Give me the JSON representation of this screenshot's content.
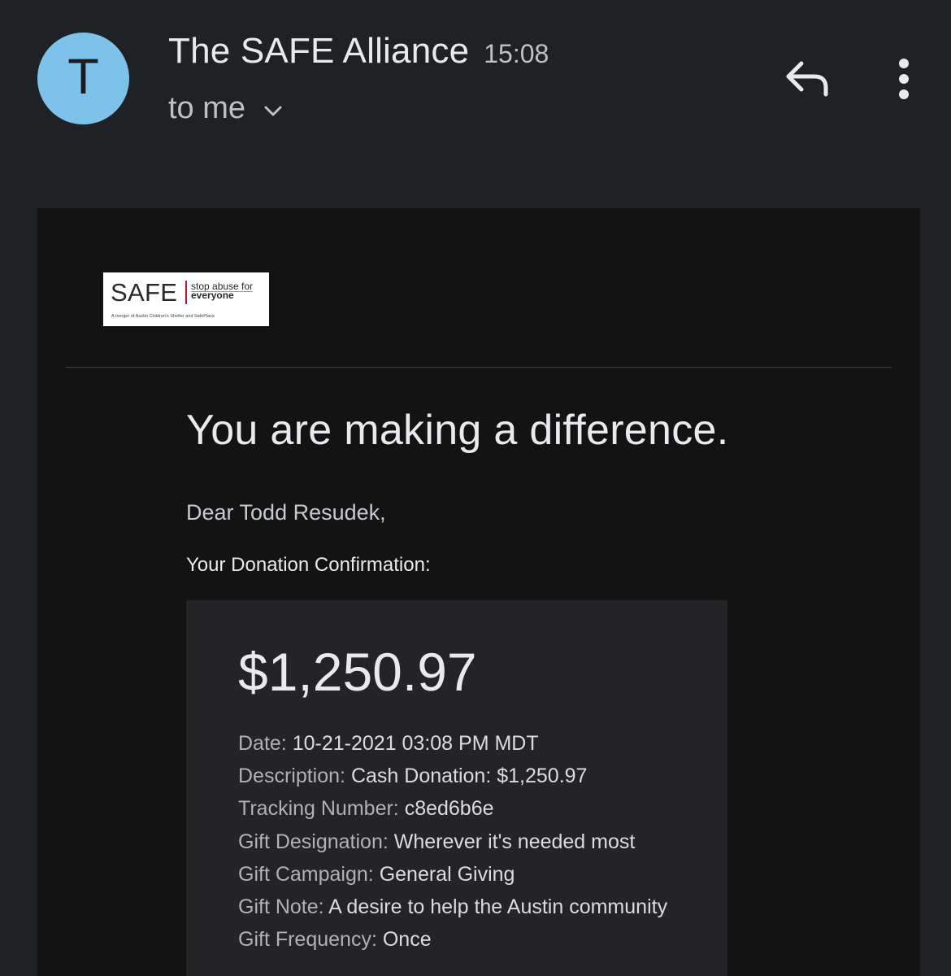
{
  "header": {
    "avatar_letter": "T",
    "avatar_color": "#7cc3ec",
    "sender_name": "The SAFE Alliance",
    "time": "15:08",
    "recipient": "to me",
    "icons": [
      "chevron-down-icon",
      "reply-icon",
      "more-vert-icon"
    ]
  },
  "logo": {
    "wordmark": "SAFE",
    "tagline_top": "stop abuse for",
    "tagline_bottom": "everyone",
    "merger_text": "A merger of Austin Children's Shelter and SafePlace",
    "accent_color": "#c8102e"
  },
  "email": {
    "headline": "You are making a difference.",
    "greeting": "Dear Todd Resudek,",
    "confirmation_label": "Your Donation Confirmation:",
    "amount": "$1,250.97",
    "details": [
      {
        "key": "Date: ",
        "value": "10-21-2021 03:08 PM MDT"
      },
      {
        "key": "Description: ",
        "value": "Cash Donation: $1,250.97"
      },
      {
        "key": "Tracking Number: ",
        "value": "c8ed6b6e"
      },
      {
        "key": "Gift Designation: ",
        "value": "Wherever it's needed most"
      },
      {
        "key": "Gift Campaign: ",
        "value": "General Giving"
      },
      {
        "key": "Gift Note: ",
        "value": "A desire to help the Austin community"
      },
      {
        "key": "Gift Frequency: ",
        "value": "Once"
      }
    ]
  }
}
